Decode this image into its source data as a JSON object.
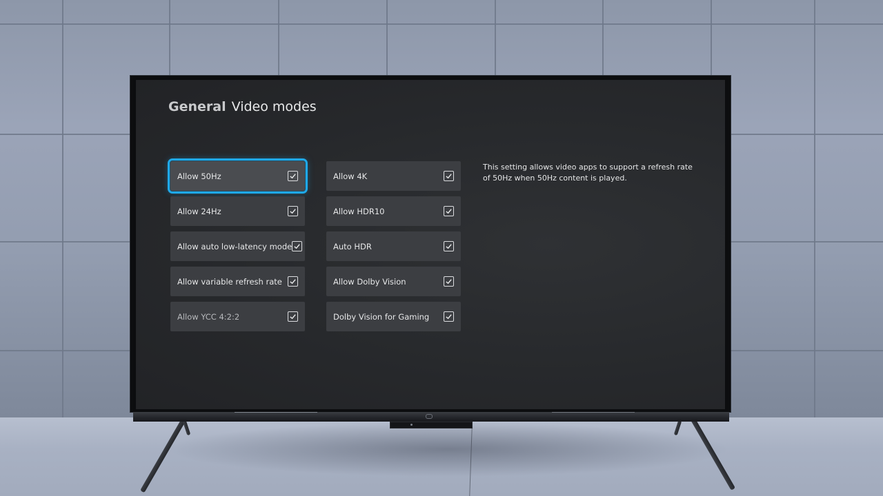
{
  "header": {
    "section": "General",
    "page": "Video modes"
  },
  "options_left": [
    {
      "label": "Allow 50Hz",
      "checked": true,
      "focused": true
    },
    {
      "label": "Allow 24Hz",
      "checked": true
    },
    {
      "label": "Allow auto low-latency mode",
      "checked": true
    },
    {
      "label": "Allow variable refresh rate",
      "checked": true
    },
    {
      "label": "Allow YCC 4:2:2",
      "checked": true
    }
  ],
  "options_right": [
    {
      "label": "Allow 4K",
      "checked": true
    },
    {
      "label": "Allow HDR10",
      "checked": true
    },
    {
      "label": "Auto HDR",
      "checked": true
    },
    {
      "label": "Allow Dolby Vision",
      "checked": true
    },
    {
      "label": "Dolby Vision for Gaming",
      "checked": true
    }
  ],
  "description": "This setting allows video apps to support a refresh rate of 50Hz when 50Hz content is played.",
  "colors": {
    "focus_ring": "#1fa9ea",
    "screen_bg": "#27292c",
    "option_bg": "#3c3e42"
  },
  "icons": {
    "checkbox": "checkbox-checked-icon"
  }
}
